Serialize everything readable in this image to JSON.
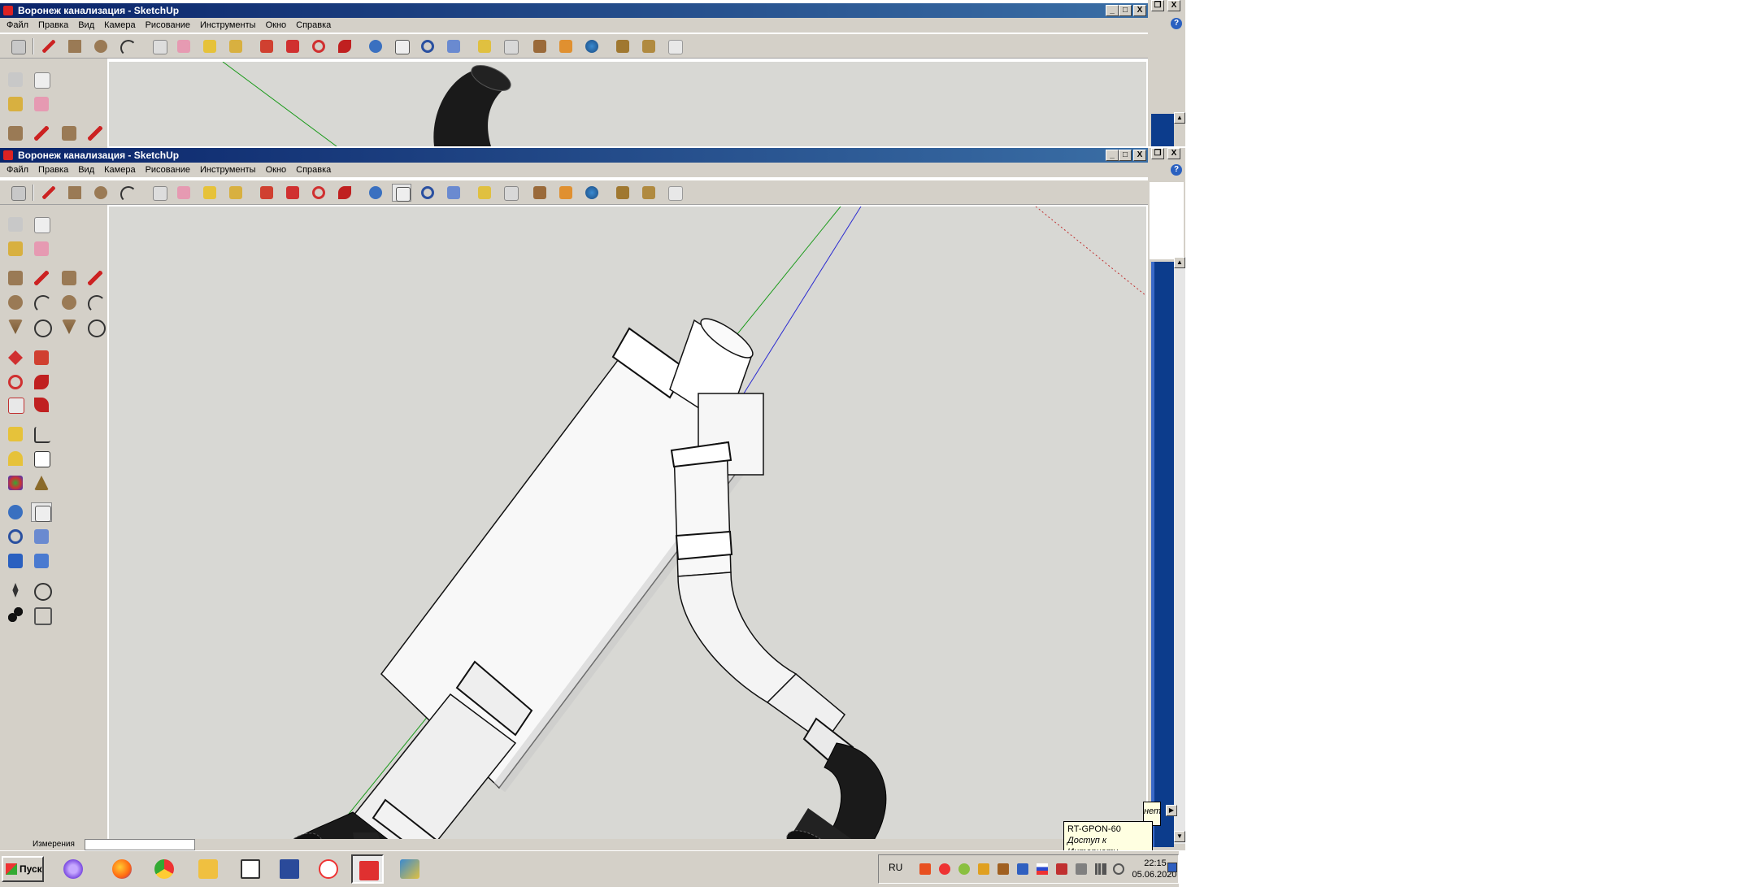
{
  "window": {
    "title": "Воронеж канализация - SketchUp",
    "controls": [
      "_",
      "□",
      "X"
    ]
  },
  "menu": [
    "Файл",
    "Правка",
    "Вид",
    "Камера",
    "Рисование",
    "Инструменты",
    "Окно",
    "Справка"
  ],
  "status": {
    "measure_label": "Измерения",
    "measure_value": ""
  },
  "taskbar": {
    "start_label": "Пуск",
    "language": "RU",
    "time": "22:15",
    "date": "05.06.2020",
    "apps": [
      "alice",
      "firefox",
      "chrome",
      "explorer",
      "calendar",
      "save",
      "yandex",
      "sketchup",
      "paint"
    ]
  },
  "tooltip": {
    "title": "RT-GPON-60",
    "text": "Доступ к Интернету",
    "partial": "нету"
  },
  "right_panel": {
    "help_icon": "?"
  },
  "colors": {
    "title_start": "#0a246a",
    "title_end": "#3a6ea5",
    "chrome": "#d4d0c8",
    "canvas": "#d8d8d4",
    "pipe": "#ffffff",
    "elbow": "#1a1a1a",
    "axis_green": "#1a9a1a",
    "axis_blue": "#2a2ad0",
    "axis_red": "#c03030"
  }
}
